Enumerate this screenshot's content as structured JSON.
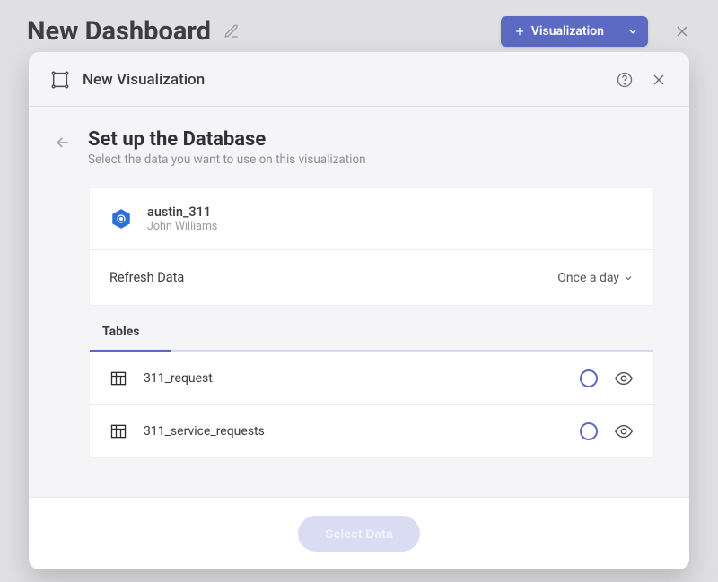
{
  "top": {
    "title": "New Dashboard",
    "viz_button": "Visualization"
  },
  "modal": {
    "title": "New Visualization",
    "heading": "Set up the Database",
    "subheading": "Select the data you want to use on this visualization",
    "database": {
      "name": "austin_311",
      "owner": "John Williams"
    },
    "refresh": {
      "label": "Refresh Data",
      "value": "Once a day"
    },
    "tables_label": "Tables",
    "tables": [
      {
        "name": "311_request"
      },
      {
        "name": "311_service_requests"
      }
    ],
    "submit_label": "Select Data"
  }
}
